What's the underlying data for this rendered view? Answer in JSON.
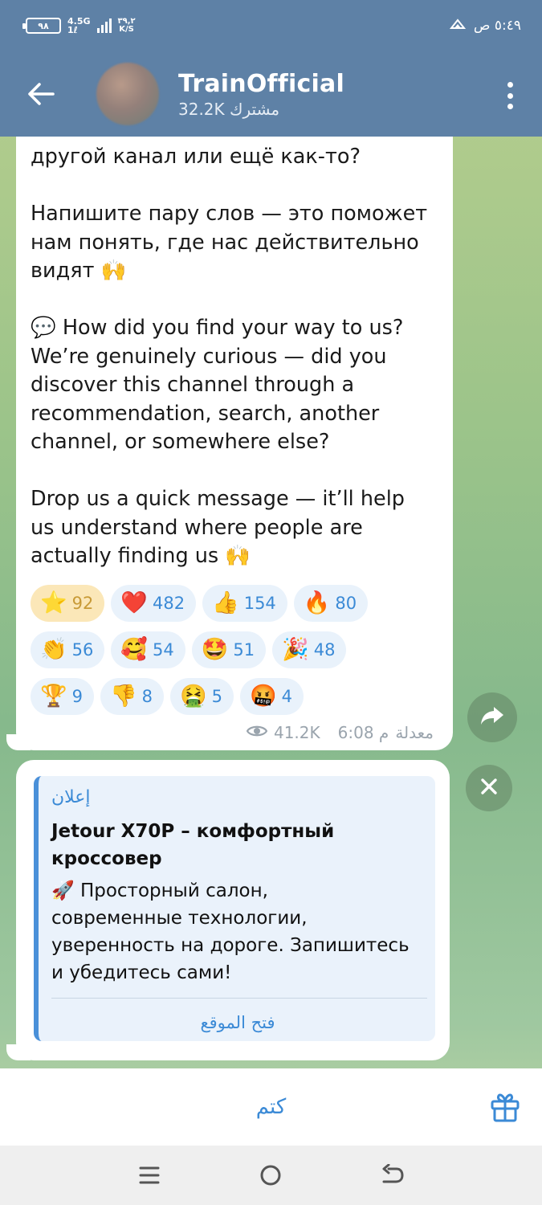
{
  "status_bar": {
    "battery": "٩٨",
    "network": "4.5G",
    "network_sub": "1ℓ",
    "speed": "٣٩,٢",
    "speed_unit": "K/S",
    "time": "٥:٤٩ ص"
  },
  "header": {
    "title": "TrainOfficial",
    "subtitle": "32.2K مشترك"
  },
  "message": {
    "lines_top": [
      "другой канал или ещё как-то?"
    ],
    "para2": [
      "Напишите пару слов — это поможет",
      "нам понять, где нас действительно",
      "видят 🙌"
    ],
    "para3": [
      "💬 How did you find your way to us?",
      "We’re genuinely curious — did you",
      "discover this channel through a",
      "recommendation, search, another",
      "channel, or somewhere else?"
    ],
    "para4": [
      "Drop us a quick message — it’ll help",
      "us understand where people are",
      "actually finding us 🙌"
    ],
    "reactions": [
      {
        "emoji": "⭐",
        "count": "92",
        "active": true
      },
      {
        "emoji": "❤️",
        "count": "482"
      },
      {
        "emoji": "👍",
        "count": "154"
      },
      {
        "emoji": "🔥",
        "count": "80"
      },
      {
        "emoji": "👏",
        "count": "56"
      },
      {
        "emoji": "🥰",
        "count": "54"
      },
      {
        "emoji": "🤩",
        "count": "51"
      },
      {
        "emoji": "🎉",
        "count": "48"
      },
      {
        "emoji": "🏆",
        "count": "9"
      },
      {
        "emoji": "👎",
        "count": "8"
      },
      {
        "emoji": "🤮",
        "count": "5"
      },
      {
        "emoji": "🤬",
        "count": "4"
      }
    ],
    "edited_label": "معدلة",
    "time": "6:08 م",
    "views": "41.2K"
  },
  "ad": {
    "label": "إعلان",
    "title_lines": [
      "Jetour X70P – комфортный",
      "кроссовер"
    ],
    "text_lines": [
      "🚀 Просторный салон,",
      "современные технологии,",
      "уверенность на дороге. Запишитесь",
      "и убедитесь сами!"
    ],
    "action": "فتح الموقع"
  },
  "bottom": {
    "mute_label": "كتم"
  },
  "colors": {
    "header_bg": "#5e81a6",
    "accent": "#3b8ad6",
    "bubble_bg": "#ffffff"
  }
}
